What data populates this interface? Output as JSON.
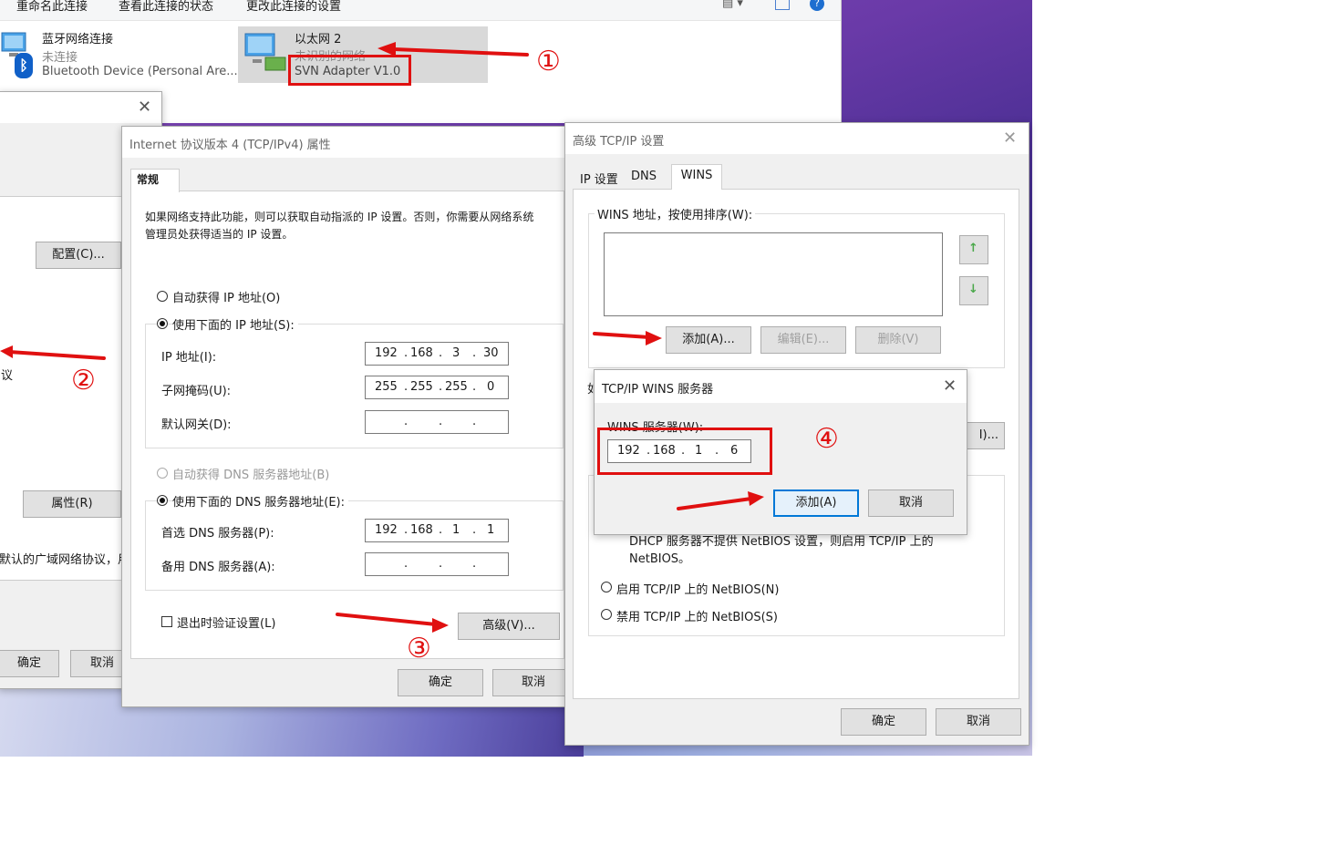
{
  "toolbar": {
    "rename": "重命名此连接",
    "status": "查看此连接的状态",
    "change": "更改此连接的设置"
  },
  "connections": [
    {
      "name": "蓝牙网络连接",
      "status": "未连接",
      "device": "Bluetooth Device (Personal Are..."
    },
    {
      "name": "以太网 2",
      "status": "未识别的网络",
      "device": "SVN Adapter V1.0"
    }
  ],
  "left_dialog": {
    "configure": "配置(C)...",
    "properties": "属性(R)",
    "ok": "确定",
    "cancel": "取消",
    "frag_protocol": "议",
    "frag_desc": "默认的广域网络协议，用"
  },
  "ipv4": {
    "title": "Internet 协议版本 4 (TCP/IPv4) 属性",
    "tab": "常规",
    "description": "如果网络支持此功能，则可以获取自动指派的 IP 设置。否则，你需要从网络系统管理员处获得适当的 IP 设置。",
    "auto_ip": "自动获得 IP 地址(O)",
    "use_ip": "使用下面的 IP 地址(S):",
    "ip_label": "IP 地址(I):",
    "ip": [
      "192",
      "168",
      "3",
      "30"
    ],
    "mask_label": "子网掩码(U):",
    "mask": [
      "255",
      "255",
      "255",
      "0"
    ],
    "gateway_label": "默认网关(D):",
    "auto_dns": "自动获得 DNS 服务器地址(B)",
    "use_dns": "使用下面的 DNS 服务器地址(E):",
    "dns1_label": "首选 DNS 服务器(P):",
    "dns1": [
      "192",
      "168",
      "1",
      "1"
    ],
    "dns2_label": "备用 DNS 服务器(A):",
    "validate": "退出时验证设置(L)",
    "advanced": "高级(V)...",
    "ok": "确定",
    "cancel": "取消"
  },
  "advanced": {
    "title": "高级 TCP/IP 设置",
    "tabs": [
      "IP 设置",
      "DNS",
      "WINS"
    ],
    "wins_group": "WINS 地址，按使用排序(W):",
    "add": "添加(A)...",
    "edit": "编辑(E)...",
    "remove": "删除(V)",
    "partial_btn": "I)...",
    "frag_left": "如",
    "netbios_text": "DHCP 服务器不提供 NetBIOS 设置，则启用 TCP/IP 上的 NetBIOS。",
    "enable_netbios": "启用 TCP/IP 上的 NetBIOS(N)",
    "disable_netbios": "禁用 TCP/IP 上的 NetBIOS(S)",
    "ok": "确定",
    "cancel": "取消"
  },
  "wins_dialog": {
    "title": "TCP/IP WINS 服务器",
    "label": "WINS 服务器(W):",
    "ip": [
      "192",
      "168",
      "1",
      "6"
    ],
    "add": "添加(A)",
    "cancel": "取消"
  },
  "annotations": [
    "①",
    "②",
    "③",
    "④"
  ],
  "colors": {
    "accent": "#0078d7",
    "annotation": "#e01010"
  }
}
